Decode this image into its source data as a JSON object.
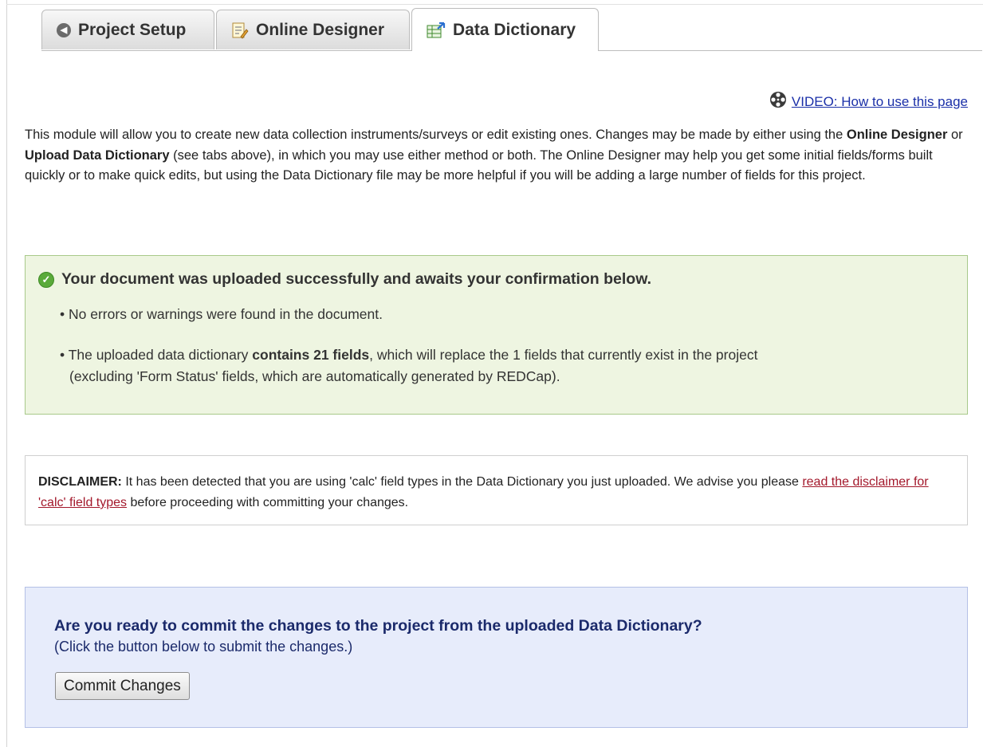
{
  "tabs": [
    {
      "label": "Project Setup",
      "icon": "back-arrow-icon",
      "active": false
    },
    {
      "label": "Online Designer",
      "icon": "form-edit-icon",
      "active": false
    },
    {
      "label": "Data Dictionary",
      "icon": "spreadsheet-upload-icon",
      "active": true
    }
  ],
  "video": {
    "link_text": "VIDEO: How to use this page",
    "icon": "film-reel-icon"
  },
  "intro": {
    "t1": "This module will allow you to create new data collection instruments/surveys or edit existing ones. Changes may be made by either using the ",
    "b1": "Online Designer",
    "t2": " or ",
    "b2": "Upload Data Dictionary",
    "t3": " (see tabs above), in which you may use either method or both. The Online Designer may help you get some initial fields/forms built quickly or to make quick edits, but using the Data Dictionary file may be more helpful if you will be adding a large number of fields for this project."
  },
  "success": {
    "title": "Your document was uploaded successfully and awaits your confirmation below.",
    "bullet1": "No errors or warnings were found in the document.",
    "bullet2_pre": "The uploaded data dictionary ",
    "bullet2_bold": "contains 21 fields",
    "bullet2_post": ", which will replace the 1 fields that currently exist in the project",
    "bullet2_cont": "(excluding 'Form Status' fields, which are automatically generated by REDCap).",
    "bullet_char": "•"
  },
  "disclaimer": {
    "label": "DISCLAIMER:",
    "text1": " It has been detected that you are using 'calc' field types in the Data Dictionary you just uploaded. We advise you please ",
    "link": "read the disclaimer for 'calc' field types",
    "text2": " before proceeding with committing your changes."
  },
  "commit": {
    "question": "Are you ready to commit the changes to the project from the uploaded Data Dictionary?",
    "sub": "(Click the button below to submit the changes.)",
    "button": "Commit Changes"
  },
  "colors": {
    "success_bg": "#eef5e1",
    "success_border": "#a8c98a",
    "commit_bg": "#e7ecfb",
    "commit_text": "#1b2a6b",
    "link": "#1a2fa8",
    "disclaimer_link": "#a3182b"
  }
}
